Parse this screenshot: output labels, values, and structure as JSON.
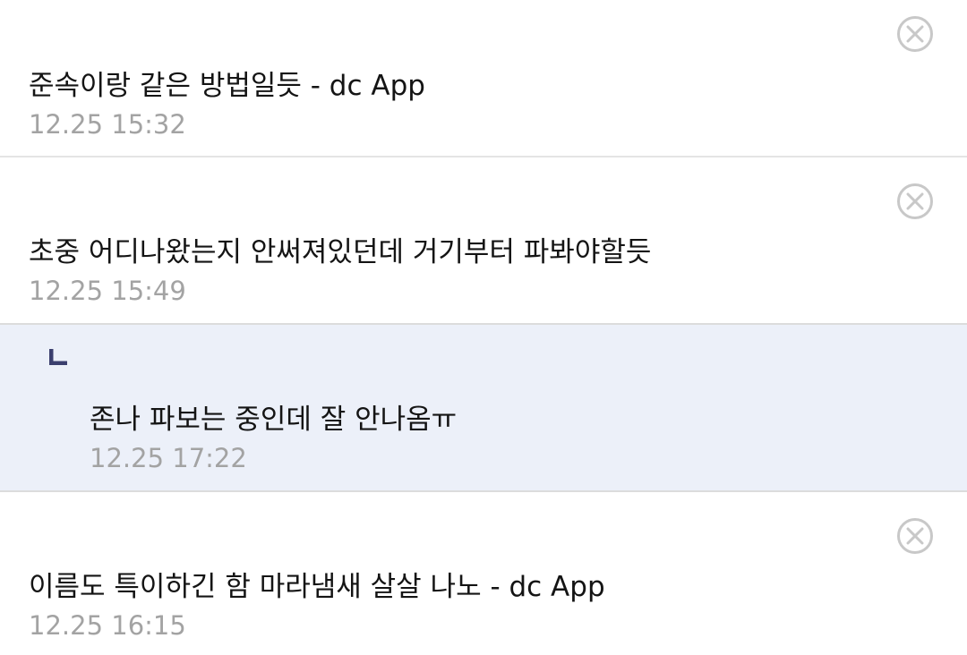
{
  "comments": [
    {
      "text": "준속이랑 같은 방법일듯 - dc App",
      "time": "12.25 15:32",
      "delete_icon": "circle-x-icon"
    },
    {
      "text": "초중 어디나왔는지 안써져있던데 거기부터 파봐야할듯",
      "time": "12.25 15:49",
      "delete_icon": "circle-x-icon"
    },
    {
      "text": "존나 파보는 중인데 잘 안나옴ㅠ",
      "time": "12.25 17:22",
      "reply_icon": "reply-arrow-icon"
    },
    {
      "text": "이름도 특이하긴 함 마라냄새 살살 나노 - dc App",
      "time": "12.25 16:15",
      "delete_icon": "circle-x-icon"
    }
  ],
  "colors": {
    "reply_background": "#ecf0f9",
    "reply_mark": "#3b3f6e",
    "timestamp": "#a3a3a3",
    "delete_icon": "#c8c8c8",
    "divider": "#dcdcdc"
  }
}
